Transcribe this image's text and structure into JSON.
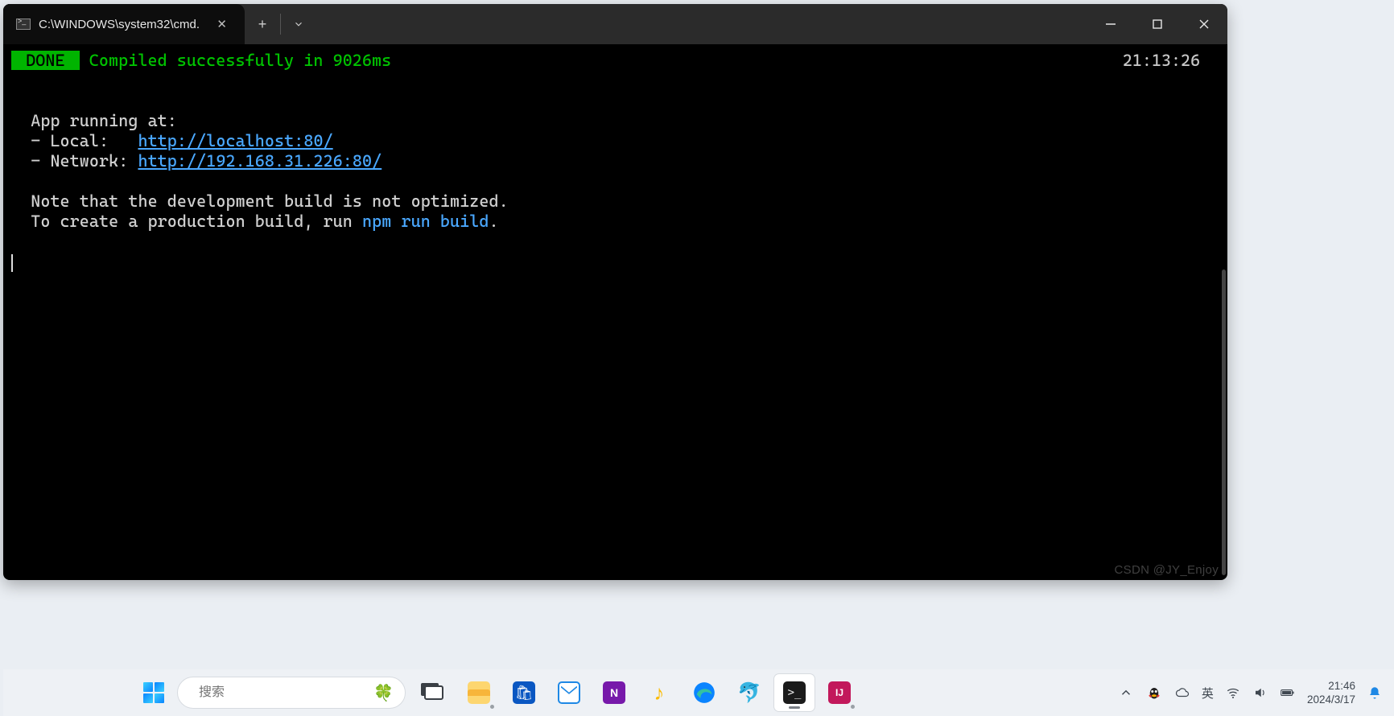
{
  "window": {
    "tab_title": "C:\\WINDOWS\\system32\\cmd.",
    "close_glyph": "✕",
    "newtab_glyph": "+",
    "min_glyph": "—",
    "max_glyph": "□",
    "x_glyph": "✕"
  },
  "terminal": {
    "badge": " DONE ",
    "compiled_msg": " Compiled successfully in 9026ms",
    "timestamp": "21:13:26",
    "line_app": "  App running at:",
    "line_local_pre": "  - Local:   ",
    "url_local": "http://localhost:80/",
    "line_net_pre": "  - Network: ",
    "url_net": "http://192.168.31.226:80/",
    "note1": "  Note that the development build is not optimized.",
    "note2_pre": "  To create a production build, run ",
    "npm_cmd": "npm run build",
    "note2_post": "."
  },
  "watermark": "CSDN @JY_Enjoy",
  "taskbar": {
    "search_placeholder": "搜索",
    "ime": "英",
    "clock_time": "21:46",
    "clock_date": "2024/3/17",
    "deco": "🍀"
  }
}
